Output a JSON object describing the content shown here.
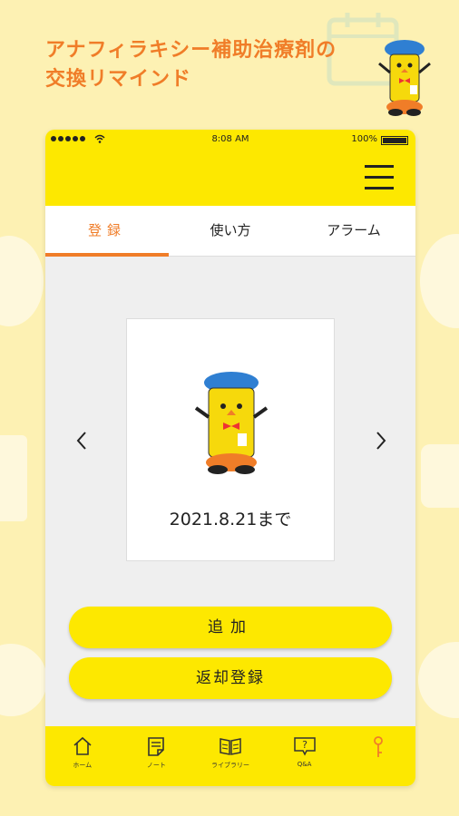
{
  "headline": {
    "line1": "アナフィラキシー補助治療剤の",
    "line2": "交換リマインド"
  },
  "status_bar": {
    "time": "8:08 AM",
    "battery": "100%"
  },
  "tabs": [
    {
      "label": "登録",
      "active": true
    },
    {
      "label": "使い方",
      "active": false
    },
    {
      "label": "アラーム",
      "active": false
    }
  ],
  "card": {
    "date": "2021.8.21まで"
  },
  "buttons": {
    "add": "追加",
    "return_register": "返却登録"
  },
  "bottom_nav": [
    {
      "label": "ホーム",
      "icon": "home-icon"
    },
    {
      "label": "ノート",
      "icon": "note-icon"
    },
    {
      "label": "ライブラリー",
      "icon": "book-icon"
    },
    {
      "label": "Q&A",
      "icon": "qa-icon"
    },
    {
      "label": "",
      "icon": "key-icon"
    }
  ],
  "colors": {
    "accent": "#f07d28",
    "yellow": "#fde800",
    "background": "#fdf1b3"
  }
}
